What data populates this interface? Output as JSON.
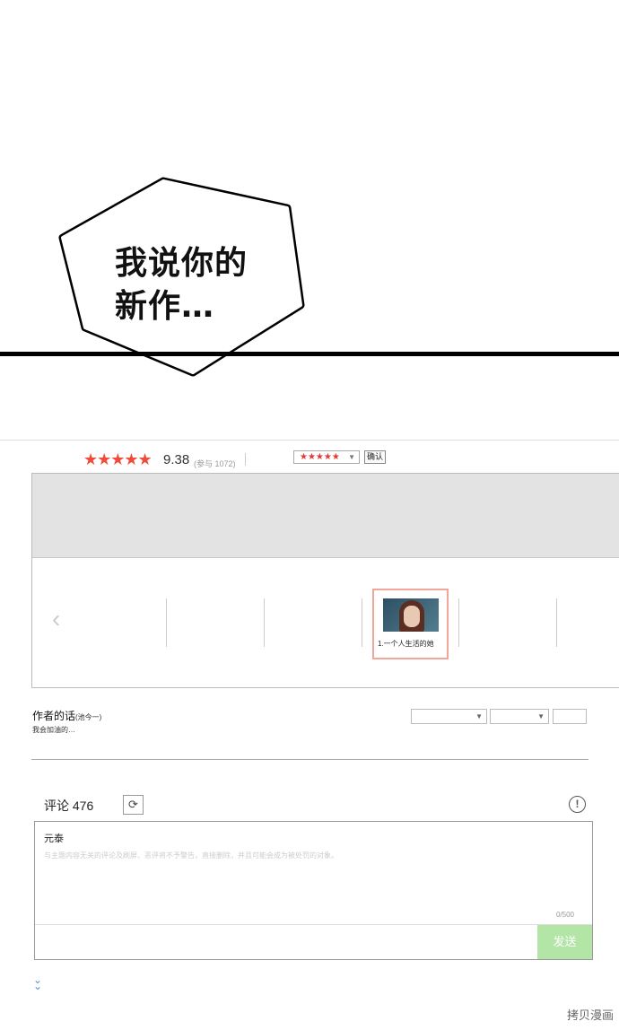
{
  "comic": {
    "bubble_line1": "我说你的",
    "bubble_line2": "新作…"
  },
  "rating": {
    "stars": "★★★★★",
    "score": "9.38",
    "votes": "(参与 1072)",
    "select_value": "★★★★★",
    "confirm_label": "确认",
    "star_color": "#f04a3a"
  },
  "episodes": {
    "prev_icon": "chevron-left-icon",
    "current_title": "1.一个人生活的她"
  },
  "author": {
    "title": "作者的话",
    "name": "(池今一)",
    "message": "我会加油的…"
  },
  "comments": {
    "title": "评论 476",
    "refresh_icon": "refresh-icon",
    "report_icon": "exclamation-icon",
    "user": "元泰",
    "placeholder": "与主题内容无关的评论及刷屏、恶评将不予警告，直接删除，并且可能会成为被处罚的对象。",
    "count": "0/500",
    "send_label": "发送",
    "send_color": "#b3e5a7"
  },
  "watermark": "拷贝漫画"
}
